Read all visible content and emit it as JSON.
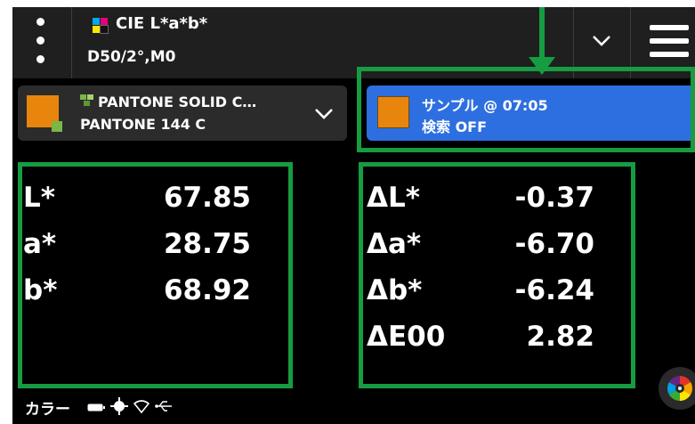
{
  "header": {
    "title": "CIE L*a*b*",
    "subtitle": "D50/2°,M0"
  },
  "reference": {
    "library": "PANTONE SOLID C…",
    "color_name": "PANTONE 144 C",
    "swatch_color": "#e8850c"
  },
  "sample": {
    "line1": "サンプル @ 07:05",
    "line2": "検索 OFF",
    "swatch_color": "#e8850c",
    "card_color": "#2d6fe0"
  },
  "values": {
    "absolute": [
      {
        "label": "L*",
        "value": "67.85"
      },
      {
        "label": "a*",
        "value": "28.75"
      },
      {
        "label": "b*",
        "value": "68.92"
      }
    ],
    "delta": [
      {
        "label": "ΔL*",
        "value": "-0.37"
      },
      {
        "label": "Δa*",
        "value": "-6.70"
      },
      {
        "label": "Δb*",
        "value": "-6.24"
      },
      {
        "label": "ΔE00",
        "value": "2.82"
      }
    ]
  },
  "status": {
    "mode_label": "カラー",
    "icons": [
      "battery-icon",
      "target-icon",
      "wifi-icon",
      "usb-icon"
    ]
  },
  "colors": {
    "highlight": "#169c41",
    "accent_blue": "#2d6fe0",
    "swatch_orange": "#e8850c"
  }
}
